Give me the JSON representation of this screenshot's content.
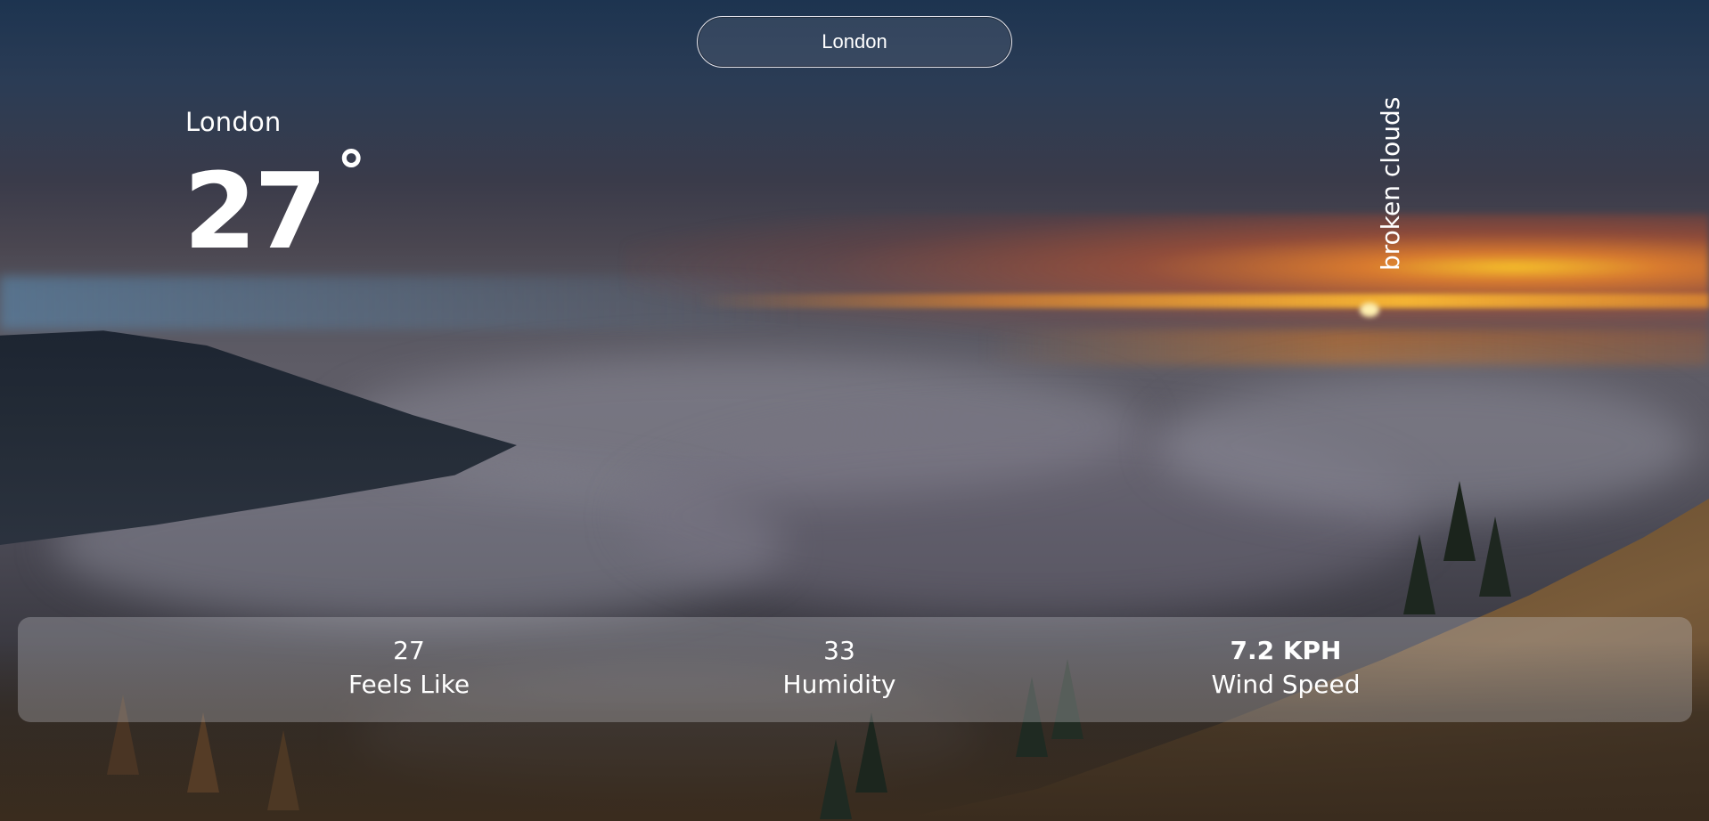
{
  "search": {
    "value": "London"
  },
  "weather": {
    "city": "London",
    "temperature": "27",
    "temperature_unit": "°",
    "description": "broken clouds"
  },
  "stats": {
    "feels_like": {
      "value": "27",
      "label": "Feels Like"
    },
    "humidity": {
      "value": "33",
      "label": "Humidity"
    },
    "wind_speed": {
      "value": "7.2 KPH",
      "label": "Wind Speed"
    }
  },
  "colors": {
    "text": "#ffffff",
    "search_border": "#e6e6ee",
    "stats_bar": "rgba(200,200,205,0.32)"
  },
  "background": {
    "icon": "misty-sunset-landscape"
  }
}
